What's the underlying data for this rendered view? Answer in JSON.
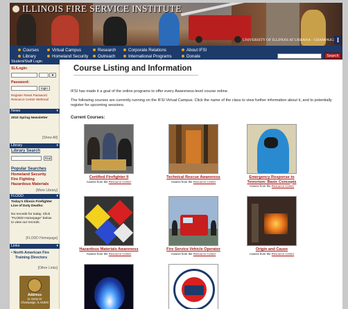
{
  "header": {
    "title": "ILLINOIS FIRE SERVICE INSTITUTE",
    "university": "UNIVERSITY OF ILLINOIS AT URBANA - CHAMPAIGN",
    "university_logo": "I"
  },
  "nav": {
    "row1": [
      "Courses",
      "Virtual Campus",
      "Research",
      "Corporate Relations",
      "About IFSI"
    ],
    "row2": [
      "Library",
      "Homeland Security",
      "Outreach",
      "International Programs",
      "Donate"
    ],
    "search_button": "Search",
    "search_value": ""
  },
  "sidebar": {
    "login": {
      "header": "Student/Staff Login",
      "id_label": "SL/Login:",
      "password_label": "Password:",
      "login_button": "login",
      "links": [
        "Register",
        "Reset Password",
        "Resource Center",
        "Webmail"
      ]
    },
    "news": {
      "header": "News",
      "item": "2010 Spring Newsletter",
      "show_all": "[Show All]"
    },
    "library": {
      "header": "Library",
      "search_label": "Library Search",
      "find_button": "Find",
      "popular_label": "Popular Searches",
      "popular": [
        "Homeland Security",
        "Fire Fighting",
        "Hazardous Materials"
      ],
      "more": "[More Library]"
    },
    "flodd": {
      "header": "FLODD",
      "title_lines": [
        "Today's Illinois Firefighter",
        "Line of Duty Deaths:"
      ],
      "body_lines": [
        "No records for today. Click",
        "\"FLODD Homepage\" below",
        "to view our records."
      ],
      "link": "[FLODD Homepage]"
    },
    "links": {
      "header": "Links",
      "item_lines": [
        "North American Fire",
        "Training Directors"
      ],
      "more": "[Other Links]"
    },
    "address": {
      "title": "Address",
      "lines": [
        "11 Gerty Dr",
        "Champaign, IL 61820"
      ]
    }
  },
  "main": {
    "title": "Course Listing and Information",
    "intro": "IFSI has made it a goal of the online programs to offer every Awareness-level course online.",
    "desc": "The following courses are currently running on the IFSI Virtual Campus. Click the name of the class to view further information about it, and to potentially register for upcoming sessions.",
    "current_label": "Current Courses:",
    "avail_prefix": "Assess from the",
    "avail_link": "Resource Center",
    "courses": [
      {
        "name": "Certified Firefighter II"
      },
      {
        "name": "Technical Rescue Awareness"
      },
      {
        "name": "Emergency Response to Terrorism: Basic Concepts"
      },
      {
        "name": "Hazardous Materials Awareness"
      },
      {
        "name": "Fire Service Vehicle Operator"
      },
      {
        "name": "Origin and Cause"
      },
      {
        "name": ""
      },
      {
        "name": ""
      }
    ]
  },
  "colors": {
    "nav_bg": "#1c3a6a",
    "accent_red": "#a01818",
    "bullet": "#e1a420"
  }
}
